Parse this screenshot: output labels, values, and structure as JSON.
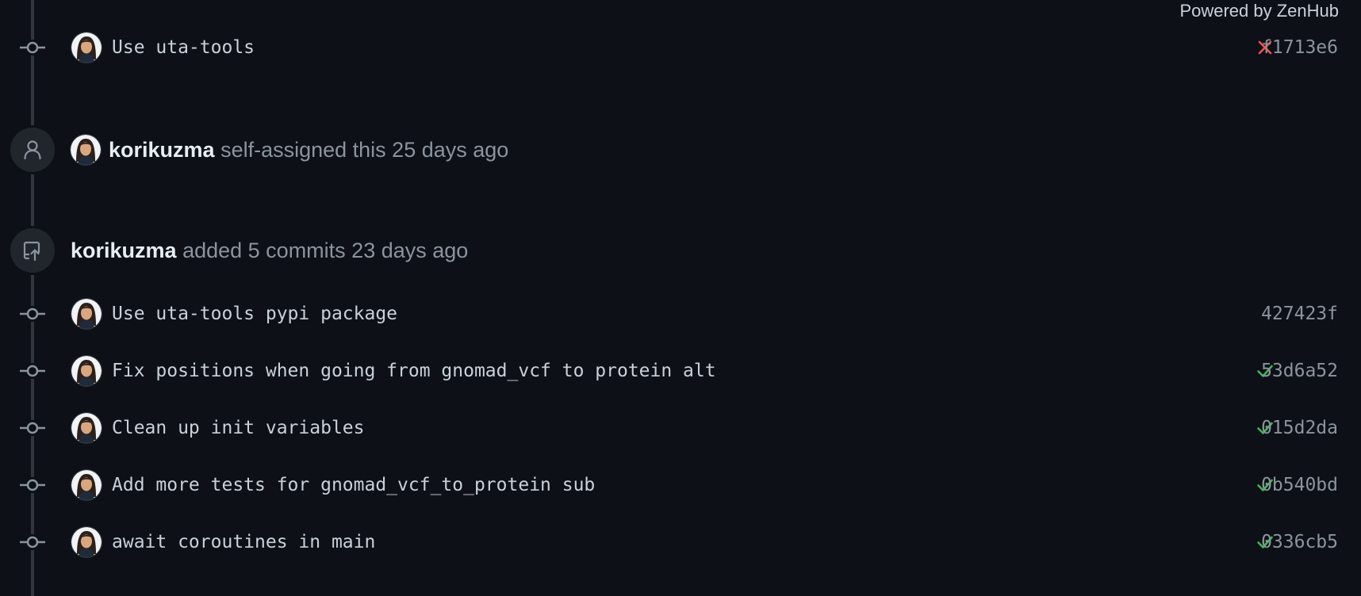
{
  "header": {
    "powered_by": "Powered by ZenHub"
  },
  "top_commit": {
    "message": "Use uta-tools",
    "status": "failure",
    "sha": "f1713e6"
  },
  "assign_event": {
    "actor": "korikuzma",
    "text": "self-assigned this 25 days ago"
  },
  "commits_event": {
    "actor": "korikuzma",
    "text": "added 5 commits 23 days ago"
  },
  "commits": [
    {
      "message": "Use uta-tools pypi package",
      "status": "none",
      "sha": "427423f"
    },
    {
      "message": "Fix positions when going from gnomad_vcf to protein alt",
      "status": "success",
      "sha": "53d6a52"
    },
    {
      "message": "Clean up init variables",
      "status": "success",
      "sha": "015d2da"
    },
    {
      "message": "Add more tests for gnomad_vcf_to_protein sub",
      "status": "success",
      "sha": "0b540bd"
    },
    {
      "message": "await coroutines in main",
      "status": "success",
      "sha": "0336cb5"
    }
  ],
  "colors": {
    "background": "#0d1117",
    "success": "#3fb950",
    "failure": "#f85149",
    "muted": "#8b949e",
    "badge": "#21262d"
  }
}
